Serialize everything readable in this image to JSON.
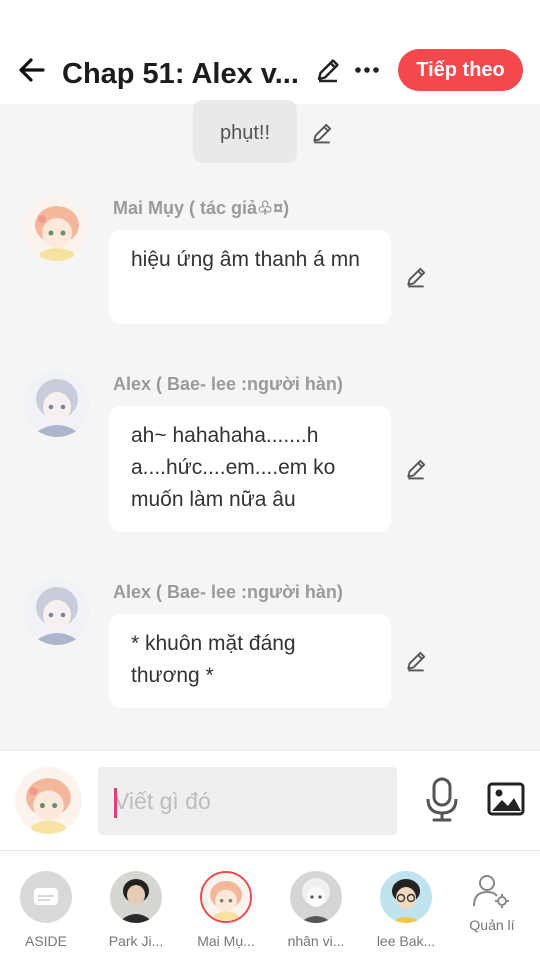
{
  "header": {
    "title": "Chap 51: Alex v...",
    "next_label": "Tiếp theo"
  },
  "messages": {
    "top_fragment": "phụt!!",
    "items": [
      {
        "author": "Mai Mụy ( tác giả♧¤)",
        "text": " hiệu ứng âm thanh á mn"
      },
      {
        "author": "Alex (  Bae- lee :người hàn)",
        "text": " ah~ hahahaha.......h a....hức....em....em ko muốn làm nữa âu"
      },
      {
        "author": "Alex (  Bae- lee :người hàn)",
        "text": "* khuôn mặt đáng thương *"
      }
    ]
  },
  "composer": {
    "placeholder": "Viết gì đó"
  },
  "bottom_bar": {
    "items": [
      {
        "label": "ASIDE"
      },
      {
        "label": "Park Ji..."
      },
      {
        "label": "Mai Mụ..."
      },
      {
        "label": "nhân vi..."
      },
      {
        "label": "lee Bak..."
      },
      {
        "label": "Quản lí"
      }
    ]
  },
  "icons": {
    "back": "arrow-left-icon",
    "edit": "pencil-icon",
    "more": "more-horizontal-icon",
    "mic": "microphone-icon",
    "image": "image-icon",
    "manage": "user-gear-icon"
  },
  "colors": {
    "accent": "#f5484c",
    "background": "#f5f5f5",
    "caret": "#e23d7b"
  }
}
